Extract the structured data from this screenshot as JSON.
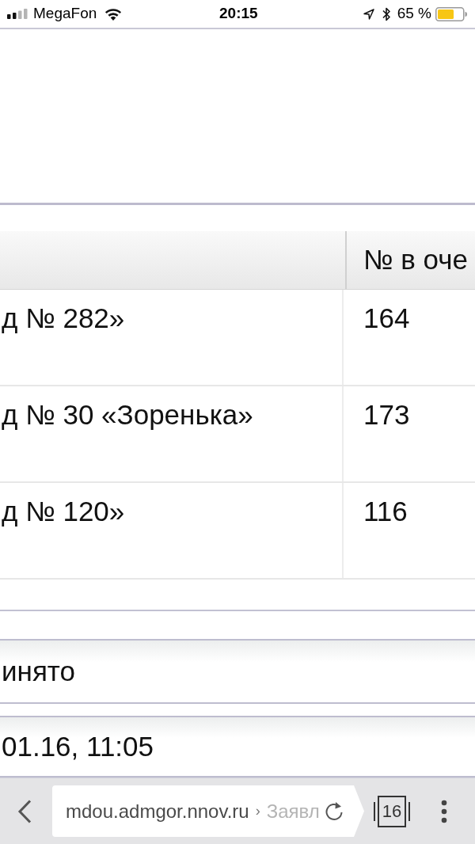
{
  "status_bar": {
    "carrier": "MegaFon",
    "time": "20:15",
    "battery": "65 %"
  },
  "table": {
    "column_2_header": "№ в оче",
    "rows": [
      {
        "column_1": "д № 282»",
        "column_2": "164"
      },
      {
        "column_1": "д № 30 «Зоренька»",
        "column_2": "173"
      },
      {
        "column_1": "д № 120»",
        "column_2": "116"
      }
    ]
  },
  "details": [
    {
      "text": "инято"
    },
    {
      "text": "01.16, 11:05"
    }
  ],
  "browser_toolbar": {
    "address": {
      "host": "mdou.admgor.nnov.ru",
      "separator": "›",
      "path": "Заявл"
    },
    "tab_count": "16"
  }
}
